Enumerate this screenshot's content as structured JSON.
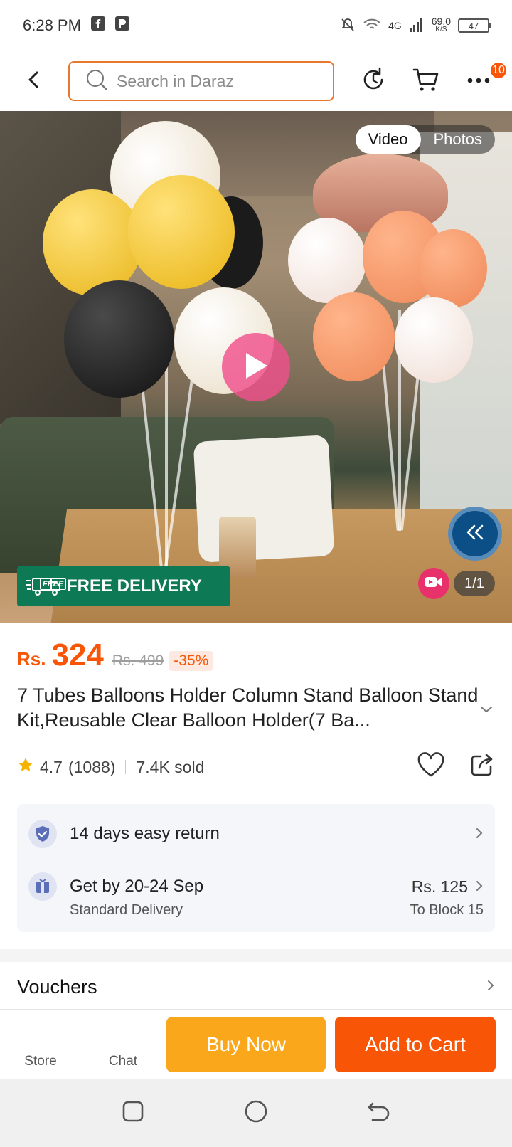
{
  "status_bar": {
    "time": "6:28 PM",
    "network": "4G",
    "speed_value": "69.0",
    "speed_unit": "K/S",
    "battery": "47",
    "icons": [
      "facebook-icon",
      "notification-app-icon",
      "mute-bell-icon",
      "wifi-icon",
      "signal-icon",
      "battery-icon"
    ]
  },
  "top_bar": {
    "search_placeholder": "Search in Daraz",
    "more_badge": "10"
  },
  "gallery": {
    "tab_video": "Video",
    "tab_photos": "Photos",
    "free_delivery": "FREE DELIVERY",
    "free_tag": "FREE",
    "counter": "1/1"
  },
  "price": {
    "currency": "Rs.",
    "value": "324",
    "original": "Rs. 499",
    "discount": "-35%"
  },
  "product": {
    "title": "7 Tubes Balloons Holder Column Stand Balloon Stand Kit,Reusable Clear Balloon Holder(7 Ba...",
    "rating": "4.7",
    "review_count": "(1088)",
    "sold": "7.4K sold"
  },
  "services": {
    "return_text": "14 days easy return",
    "delivery_text": "Get by 20-24 Sep",
    "delivery_sub": "Standard Delivery",
    "delivery_fee": "Rs. 125",
    "delivery_location": "To Block 15"
  },
  "vouchers": {
    "title": "Vouchers"
  },
  "bottom_bar": {
    "store_label": "Store",
    "chat_label": "Chat",
    "buy_now": "Buy Now",
    "add_to_cart": "Add to Cart"
  },
  "colors": {
    "accent": "#f85606",
    "buy_now": "#fba71b",
    "free_delivery": "#0e7a55",
    "search_border": "#e8782e"
  }
}
